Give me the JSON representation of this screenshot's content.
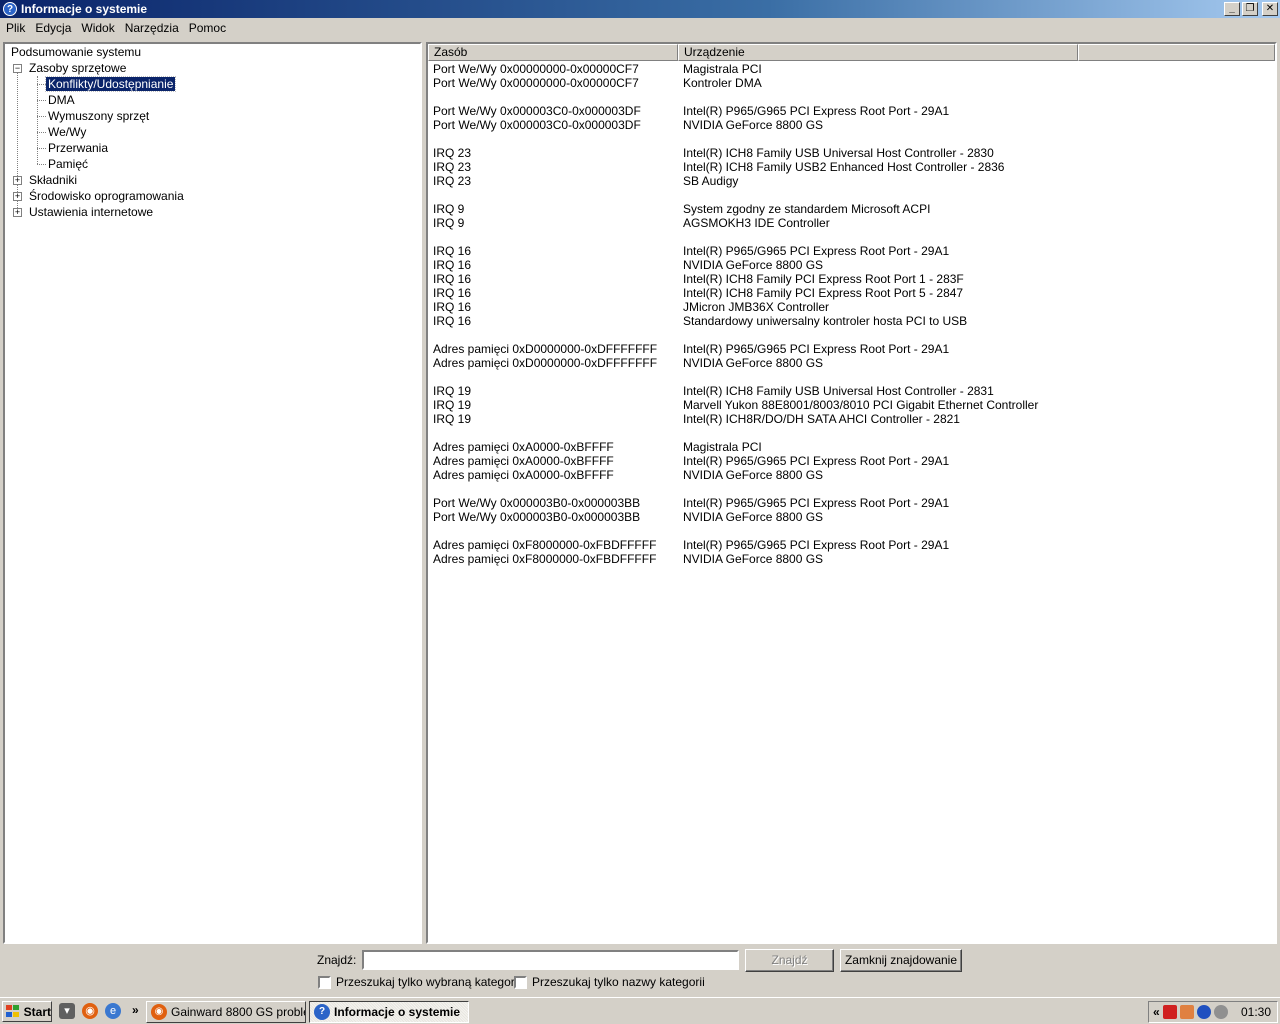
{
  "window": {
    "title": "Informacje o systemie"
  },
  "menu": [
    "Plik",
    "Edycja",
    "Widok",
    "Narzędzia",
    "Pomoc"
  ],
  "tree": {
    "root": "Podsumowanie systemu",
    "hardware": "Zasoby sprzętowe",
    "hardware_children": [
      "Konflikty/Udostępnianie",
      "DMA",
      "Wymuszony sprzęt",
      "We/Wy",
      "Przerwania",
      "Pamięć"
    ],
    "components": "Składniki",
    "software": "Środowisko oprogramowania",
    "internet": "Ustawienia internetowe"
  },
  "list": {
    "columns": [
      "Zasób",
      "Urządzenie",
      ""
    ],
    "rows": [
      [
        "Port We/Wy 0x00000000-0x00000CF7",
        "Magistrala PCI"
      ],
      [
        "Port We/Wy 0x00000000-0x00000CF7",
        "Kontroler DMA"
      ],
      [
        "",
        ""
      ],
      [
        "Port We/Wy 0x000003C0-0x000003DF",
        "Intel(R) P965/G965 PCI Express Root Port - 29A1"
      ],
      [
        "Port We/Wy 0x000003C0-0x000003DF",
        "NVIDIA GeForce 8800 GS"
      ],
      [
        "",
        ""
      ],
      [
        "IRQ 23",
        "Intel(R) ICH8 Family USB Universal Host Controller - 2830"
      ],
      [
        "IRQ 23",
        "Intel(R) ICH8 Family USB2 Enhanced Host Controller - 2836"
      ],
      [
        "IRQ 23",
        "SB Audigy"
      ],
      [
        "",
        ""
      ],
      [
        "IRQ 9",
        "System zgodny ze standardem Microsoft ACPI"
      ],
      [
        "IRQ 9",
        "AGSMOKH3 IDE Controller"
      ],
      [
        "",
        ""
      ],
      [
        "IRQ 16",
        "Intel(R) P965/G965 PCI Express Root Port - 29A1"
      ],
      [
        "IRQ 16",
        "NVIDIA GeForce 8800 GS"
      ],
      [
        "IRQ 16",
        "Intel(R) ICH8 Family PCI Express Root Port 1 - 283F"
      ],
      [
        "IRQ 16",
        "Intel(R) ICH8 Family PCI Express Root Port 5 - 2847"
      ],
      [
        "IRQ 16",
        "JMicron JMB36X Controller"
      ],
      [
        "IRQ 16",
        "Standardowy uniwersalny kontroler hosta PCI to USB"
      ],
      [
        "",
        ""
      ],
      [
        "Adres pamięci 0xD0000000-0xDFFFFFFF",
        "Intel(R) P965/G965 PCI Express Root Port - 29A1"
      ],
      [
        "Adres pamięci 0xD0000000-0xDFFFFFFF",
        "NVIDIA GeForce 8800 GS"
      ],
      [
        "",
        ""
      ],
      [
        "IRQ 19",
        "Intel(R) ICH8 Family USB Universal Host Controller - 2831"
      ],
      [
        "IRQ 19",
        "Marvell Yukon 88E8001/8003/8010 PCI Gigabit Ethernet Controller"
      ],
      [
        "IRQ 19",
        "Intel(R) ICH8R/DO/DH SATA AHCI Controller - 2821"
      ],
      [
        "",
        ""
      ],
      [
        "Adres pamięci 0xA0000-0xBFFFF",
        "Magistrala PCI"
      ],
      [
        "Adres pamięci 0xA0000-0xBFFFF",
        "Intel(R) P965/G965 PCI Express Root Port - 29A1"
      ],
      [
        "Adres pamięci 0xA0000-0xBFFFF",
        "NVIDIA GeForce 8800 GS"
      ],
      [
        "",
        ""
      ],
      [
        "Port We/Wy 0x000003B0-0x000003BB",
        "Intel(R) P965/G965 PCI Express Root Port - 29A1"
      ],
      [
        "Port We/Wy 0x000003B0-0x000003BB",
        "NVIDIA GeForce 8800 GS"
      ],
      [
        "",
        ""
      ],
      [
        "Adres pamięci 0xF8000000-0xFBDFFFFF",
        "Intel(R) P965/G965 PCI Express Root Port - 29A1"
      ],
      [
        "Adres pamięci 0xF8000000-0xFBDFFFFF",
        "NVIDIA GeForce 8800 GS"
      ]
    ]
  },
  "find": {
    "label": "Znajdź:",
    "value": "",
    "find_button": "Znajdź",
    "close_button": "Zamknij znajdowanie",
    "only_selected": "Przeszukaj tylko wybraną kategorię",
    "only_names": "Przeszukaj tylko nazwy kategorii"
  },
  "taskbar": {
    "start": "Start",
    "chevron": "»",
    "tasks": [
      "Gainward 8800 GS proble...",
      "Informacje o systemie"
    ],
    "tray_chevron": "«",
    "clock": "01:30"
  }
}
